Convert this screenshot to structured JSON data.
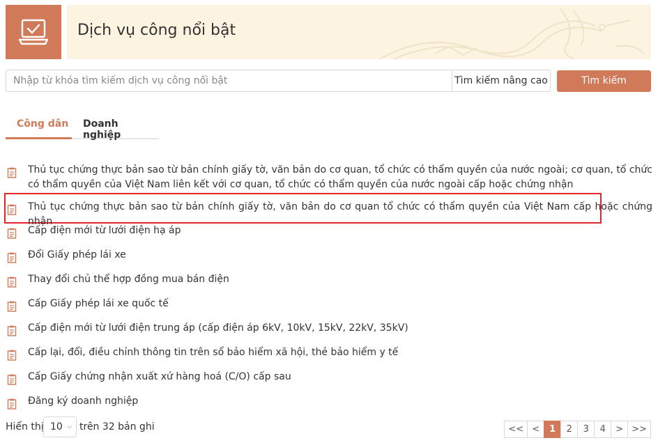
{
  "header": {
    "title": "Dịch vụ công nổi bật",
    "icon": "laptop-check-icon"
  },
  "search": {
    "placeholder": "Nhập từ khóa tìm kiếm dịch vụ công nổi bật",
    "value": "",
    "advanced_label": "Tìm kiếm nâng cao",
    "button_label": "Tìm kiếm"
  },
  "tabs": [
    {
      "label": "Công dân",
      "active": true
    },
    {
      "label": "Doanh nghiệp",
      "active": false
    }
  ],
  "services": [
    {
      "text": "Thủ tục chứng thực bản sao từ bản chính giấy tờ, văn bản do cơ quan, tổ chức có thẩm quyền của nước ngoài; cơ quan, tổ chức có thẩm quyền của Việt Nam liên kết với cơ quan, tổ chức có thẩm quyền của nước ngoài cấp hoặc chứng nhận"
    },
    {
      "text": "Thủ tục chứng thực bản sao từ bản chính giấy tờ, văn bản do cơ quan tổ chức có thẩm quyền của Việt Nam cấp hoặc chứng nhận"
    },
    {
      "text": "Cấp điện mới từ lưới điện hạ áp"
    },
    {
      "text": "Đổi Giấy phép lái xe"
    },
    {
      "text": "Thay đổi chủ thể hợp đồng mua bán điện"
    },
    {
      "text": "Cấp Giấy phép lái xe quốc tế"
    },
    {
      "text": "Cấp điện mới từ lưới điện trung áp (cấp điện áp 6kV, 10kV, 15kV, 22kV, 35kV)"
    },
    {
      "text": "Cấp lại, đổi, điều chỉnh thông tin trên sổ bảo hiểm xã hội, thẻ bảo hiểm y tế"
    },
    {
      "text": "Cấp Giấy chứng nhận xuất xứ hàng hoá (C/O) cấp sau"
    },
    {
      "text": "Đăng ký doanh nghiệp"
    }
  ],
  "footer": {
    "show_label": "Hiển thị",
    "page_size": "10",
    "total_label": "trên 32 bản ghi"
  },
  "pagination": {
    "first": "<<",
    "prev": "<",
    "pages": [
      "1",
      "2",
      "3",
      "4"
    ],
    "current": "1",
    "next": ">",
    "last": ">>"
  },
  "colors": {
    "accent": "#d07a5a",
    "banner": "#fcf3e1",
    "highlight": "#e0262b"
  }
}
